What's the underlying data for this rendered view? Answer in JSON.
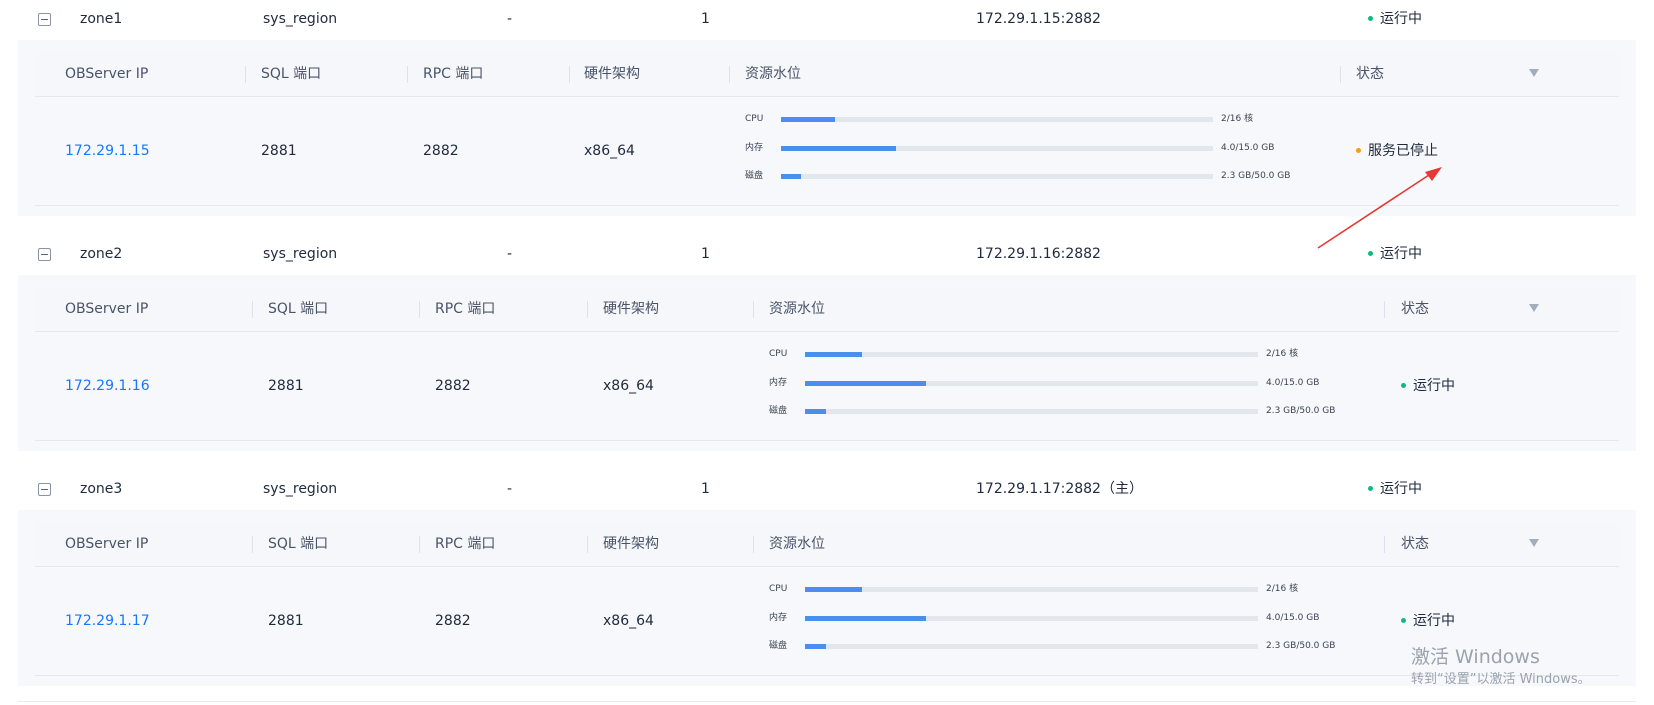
{
  "columns": {
    "ip": "OBServer IP",
    "sql_port": "SQL 端口",
    "rpc_port": "RPC 端口",
    "arch": "硬件架构",
    "resource": "资源水位",
    "status": "状态"
  },
  "zones": [
    {
      "name": "zone1",
      "region": "sys_region",
      "dash": "-",
      "count": "1",
      "address": "172.29.1.15:2882",
      "status": "运行中",
      "status_color": "#10b981",
      "server": {
        "ip": "172.29.1.15",
        "sql_port": "2881",
        "rpc_port": "2882",
        "arch": "x86_64",
        "status": "服务已停止",
        "status_color": "#f59e0b",
        "resources": [
          {
            "label": "CPU",
            "value": "2/16 核",
            "fraction": 0.125
          },
          {
            "label": "内存",
            "value": "4.0/15.0 GB",
            "fraction": 0.267
          },
          {
            "label": "磁盘",
            "value": "2.3 GB/50.0 GB",
            "fraction": 0.046
          }
        ]
      }
    },
    {
      "name": "zone2",
      "region": "sys_region",
      "dash": "-",
      "count": "1",
      "address": "172.29.1.16:2882",
      "status": "运行中",
      "status_color": "#10b981",
      "server": {
        "ip": "172.29.1.16",
        "sql_port": "2881",
        "rpc_port": "2882",
        "arch": "x86_64",
        "status": "运行中",
        "status_color": "#10b981",
        "resources": [
          {
            "label": "CPU",
            "value": "2/16 核",
            "fraction": 0.125
          },
          {
            "label": "内存",
            "value": "4.0/15.0 GB",
            "fraction": 0.267
          },
          {
            "label": "磁盘",
            "value": "2.3 GB/50.0 GB",
            "fraction": 0.046
          }
        ]
      }
    },
    {
      "name": "zone3",
      "region": "sys_region",
      "dash": "-",
      "count": "1",
      "address": "172.29.1.17:2882（主）",
      "status": "运行中",
      "status_color": "#10b981",
      "server": {
        "ip": "172.29.1.17",
        "sql_port": "2881",
        "rpc_port": "2882",
        "arch": "x86_64",
        "status": "运行中",
        "status_color": "#10b981",
        "resources": [
          {
            "label": "CPU",
            "value": "2/16 核",
            "fraction": 0.125
          },
          {
            "label": "内存",
            "value": "4.0/15.0 GB",
            "fraction": 0.267
          },
          {
            "label": "磁盘",
            "value": "2.3 GB/50.0 GB",
            "fraction": 0.046
          }
        ]
      }
    }
  ],
  "watermark": {
    "line1": "激活 Windows",
    "line2": "转到“设置”以激活 Windows。"
  },
  "annotation": {
    "icon": "red-arrow-icon",
    "color": "#e53935"
  }
}
